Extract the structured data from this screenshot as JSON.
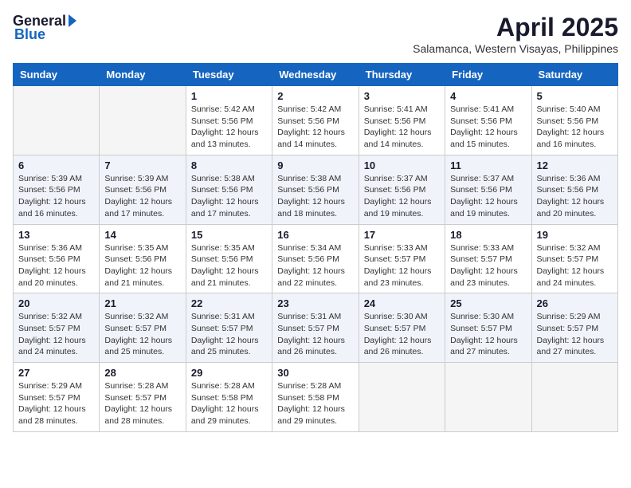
{
  "header": {
    "logo_general": "General",
    "logo_blue": "Blue",
    "month_year": "April 2025",
    "location": "Salamanca, Western Visayas, Philippines"
  },
  "weekdays": [
    "Sunday",
    "Monday",
    "Tuesday",
    "Wednesday",
    "Thursday",
    "Friday",
    "Saturday"
  ],
  "weeks": [
    {
      "shaded": false,
      "days": [
        {
          "number": "",
          "info": ""
        },
        {
          "number": "",
          "info": ""
        },
        {
          "number": "1",
          "info": "Sunrise: 5:42 AM\nSunset: 5:56 PM\nDaylight: 12 hours\nand 13 minutes."
        },
        {
          "number": "2",
          "info": "Sunrise: 5:42 AM\nSunset: 5:56 PM\nDaylight: 12 hours\nand 14 minutes."
        },
        {
          "number": "3",
          "info": "Sunrise: 5:41 AM\nSunset: 5:56 PM\nDaylight: 12 hours\nand 14 minutes."
        },
        {
          "number": "4",
          "info": "Sunrise: 5:41 AM\nSunset: 5:56 PM\nDaylight: 12 hours\nand 15 minutes."
        },
        {
          "number": "5",
          "info": "Sunrise: 5:40 AM\nSunset: 5:56 PM\nDaylight: 12 hours\nand 16 minutes."
        }
      ]
    },
    {
      "shaded": true,
      "days": [
        {
          "number": "6",
          "info": "Sunrise: 5:39 AM\nSunset: 5:56 PM\nDaylight: 12 hours\nand 16 minutes."
        },
        {
          "number": "7",
          "info": "Sunrise: 5:39 AM\nSunset: 5:56 PM\nDaylight: 12 hours\nand 17 minutes."
        },
        {
          "number": "8",
          "info": "Sunrise: 5:38 AM\nSunset: 5:56 PM\nDaylight: 12 hours\nand 17 minutes."
        },
        {
          "number": "9",
          "info": "Sunrise: 5:38 AM\nSunset: 5:56 PM\nDaylight: 12 hours\nand 18 minutes."
        },
        {
          "number": "10",
          "info": "Sunrise: 5:37 AM\nSunset: 5:56 PM\nDaylight: 12 hours\nand 19 minutes."
        },
        {
          "number": "11",
          "info": "Sunrise: 5:37 AM\nSunset: 5:56 PM\nDaylight: 12 hours\nand 19 minutes."
        },
        {
          "number": "12",
          "info": "Sunrise: 5:36 AM\nSunset: 5:56 PM\nDaylight: 12 hours\nand 20 minutes."
        }
      ]
    },
    {
      "shaded": false,
      "days": [
        {
          "number": "13",
          "info": "Sunrise: 5:36 AM\nSunset: 5:56 PM\nDaylight: 12 hours\nand 20 minutes."
        },
        {
          "number": "14",
          "info": "Sunrise: 5:35 AM\nSunset: 5:56 PM\nDaylight: 12 hours\nand 21 minutes."
        },
        {
          "number": "15",
          "info": "Sunrise: 5:35 AM\nSunset: 5:56 PM\nDaylight: 12 hours\nand 21 minutes."
        },
        {
          "number": "16",
          "info": "Sunrise: 5:34 AM\nSunset: 5:56 PM\nDaylight: 12 hours\nand 22 minutes."
        },
        {
          "number": "17",
          "info": "Sunrise: 5:33 AM\nSunset: 5:57 PM\nDaylight: 12 hours\nand 23 minutes."
        },
        {
          "number": "18",
          "info": "Sunrise: 5:33 AM\nSunset: 5:57 PM\nDaylight: 12 hours\nand 23 minutes."
        },
        {
          "number": "19",
          "info": "Sunrise: 5:32 AM\nSunset: 5:57 PM\nDaylight: 12 hours\nand 24 minutes."
        }
      ]
    },
    {
      "shaded": true,
      "days": [
        {
          "number": "20",
          "info": "Sunrise: 5:32 AM\nSunset: 5:57 PM\nDaylight: 12 hours\nand 24 minutes."
        },
        {
          "number": "21",
          "info": "Sunrise: 5:32 AM\nSunset: 5:57 PM\nDaylight: 12 hours\nand 25 minutes."
        },
        {
          "number": "22",
          "info": "Sunrise: 5:31 AM\nSunset: 5:57 PM\nDaylight: 12 hours\nand 25 minutes."
        },
        {
          "number": "23",
          "info": "Sunrise: 5:31 AM\nSunset: 5:57 PM\nDaylight: 12 hours\nand 26 minutes."
        },
        {
          "number": "24",
          "info": "Sunrise: 5:30 AM\nSunset: 5:57 PM\nDaylight: 12 hours\nand 26 minutes."
        },
        {
          "number": "25",
          "info": "Sunrise: 5:30 AM\nSunset: 5:57 PM\nDaylight: 12 hours\nand 27 minutes."
        },
        {
          "number": "26",
          "info": "Sunrise: 5:29 AM\nSunset: 5:57 PM\nDaylight: 12 hours\nand 27 minutes."
        }
      ]
    },
    {
      "shaded": false,
      "days": [
        {
          "number": "27",
          "info": "Sunrise: 5:29 AM\nSunset: 5:57 PM\nDaylight: 12 hours\nand 28 minutes."
        },
        {
          "number": "28",
          "info": "Sunrise: 5:28 AM\nSunset: 5:57 PM\nDaylight: 12 hours\nand 28 minutes."
        },
        {
          "number": "29",
          "info": "Sunrise: 5:28 AM\nSunset: 5:58 PM\nDaylight: 12 hours\nand 29 minutes."
        },
        {
          "number": "30",
          "info": "Sunrise: 5:28 AM\nSunset: 5:58 PM\nDaylight: 12 hours\nand 29 minutes."
        },
        {
          "number": "",
          "info": ""
        },
        {
          "number": "",
          "info": ""
        },
        {
          "number": "",
          "info": ""
        }
      ]
    }
  ]
}
